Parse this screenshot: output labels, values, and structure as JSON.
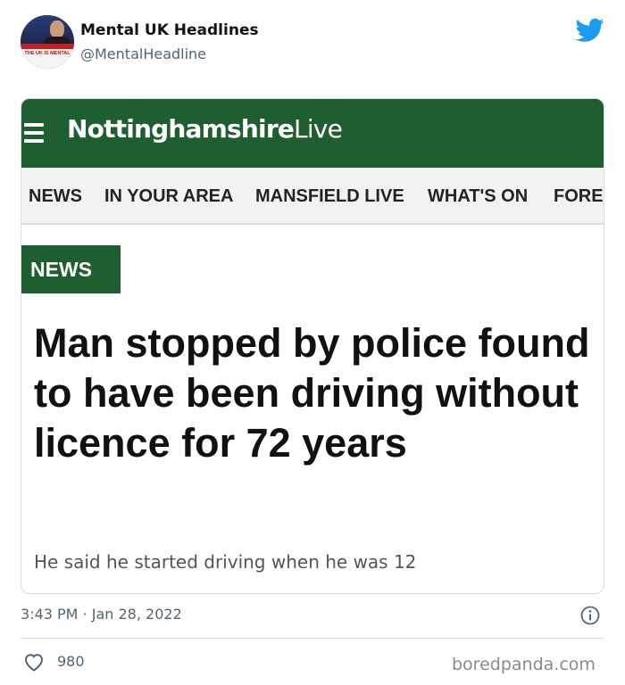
{
  "tweet": {
    "display_name": "Mental UK Headlines",
    "handle": "@MentalHeadline",
    "avatar_text": "THE UK IS MENTAL",
    "timestamp": "3:43 PM · Jan 28, 2022",
    "likes": "980"
  },
  "article": {
    "site_name_bold": "Nottinghamshire",
    "site_name_light": "Live",
    "nav": [
      "NEWS",
      "IN YOUR AREA",
      "MANSFIELD LIVE",
      "WHAT'S ON",
      "FORE"
    ],
    "section_tag": "NEWS",
    "headline": "Man stopped by police found to have been driving without licence for 72 years",
    "subhead": "He said he started driving when he was 12"
  },
  "watermark": "boredpanda.com",
  "colors": {
    "brand_green": "#1f5e2f",
    "twitter_blue": "#1d9bf0",
    "muted_text": "#536471"
  },
  "icons": {
    "bird": "twitter-bird-icon",
    "menu": "hamburger-menu-icon",
    "info": "info-icon",
    "like": "heart-icon"
  }
}
